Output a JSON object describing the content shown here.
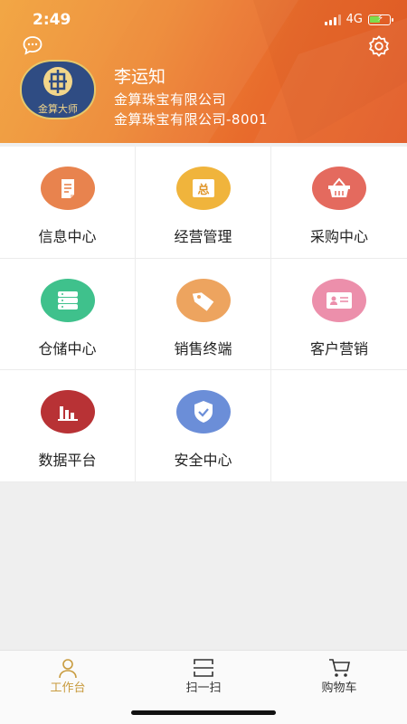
{
  "status_bar": {
    "time": "2:49",
    "network": "4G"
  },
  "header": {
    "user_name": "李运知",
    "company": "金算珠宝有限公司",
    "company_code": "金算珠宝有限公司-8001",
    "avatar_text": "金算大师",
    "colors": {
      "gradient_start": "#f2a23a",
      "gradient_end": "#e25a25"
    }
  },
  "menu": [
    {
      "label": "信息中心",
      "icon": "document-icon",
      "color": "#e8834e"
    },
    {
      "label": "经营管理",
      "icon": "summary-icon",
      "color": "#f0b43c"
    },
    {
      "label": "采购中心",
      "icon": "basket-icon",
      "color": "#e46a5e"
    },
    {
      "label": "仓储中心",
      "icon": "stack-icon",
      "color": "#3fc18c"
    },
    {
      "label": "销售终端",
      "icon": "tag-icon",
      "color": "#eda45f"
    },
    {
      "label": "客户营销",
      "icon": "id-card-icon",
      "color": "#ec8fab"
    },
    {
      "label": "数据平台",
      "icon": "bar-chart-icon",
      "color": "#b83235"
    },
    {
      "label": "安全中心",
      "icon": "shield-icon",
      "color": "#6b8ed8"
    }
  ],
  "summary_glyph": "总",
  "tabs": [
    {
      "label": "工作台",
      "icon": "person-icon",
      "active": true
    },
    {
      "label": "扫一扫",
      "icon": "scan-icon",
      "active": false
    },
    {
      "label": "购物车",
      "icon": "cart-icon",
      "active": false
    }
  ],
  "accent": "#c89b3e"
}
